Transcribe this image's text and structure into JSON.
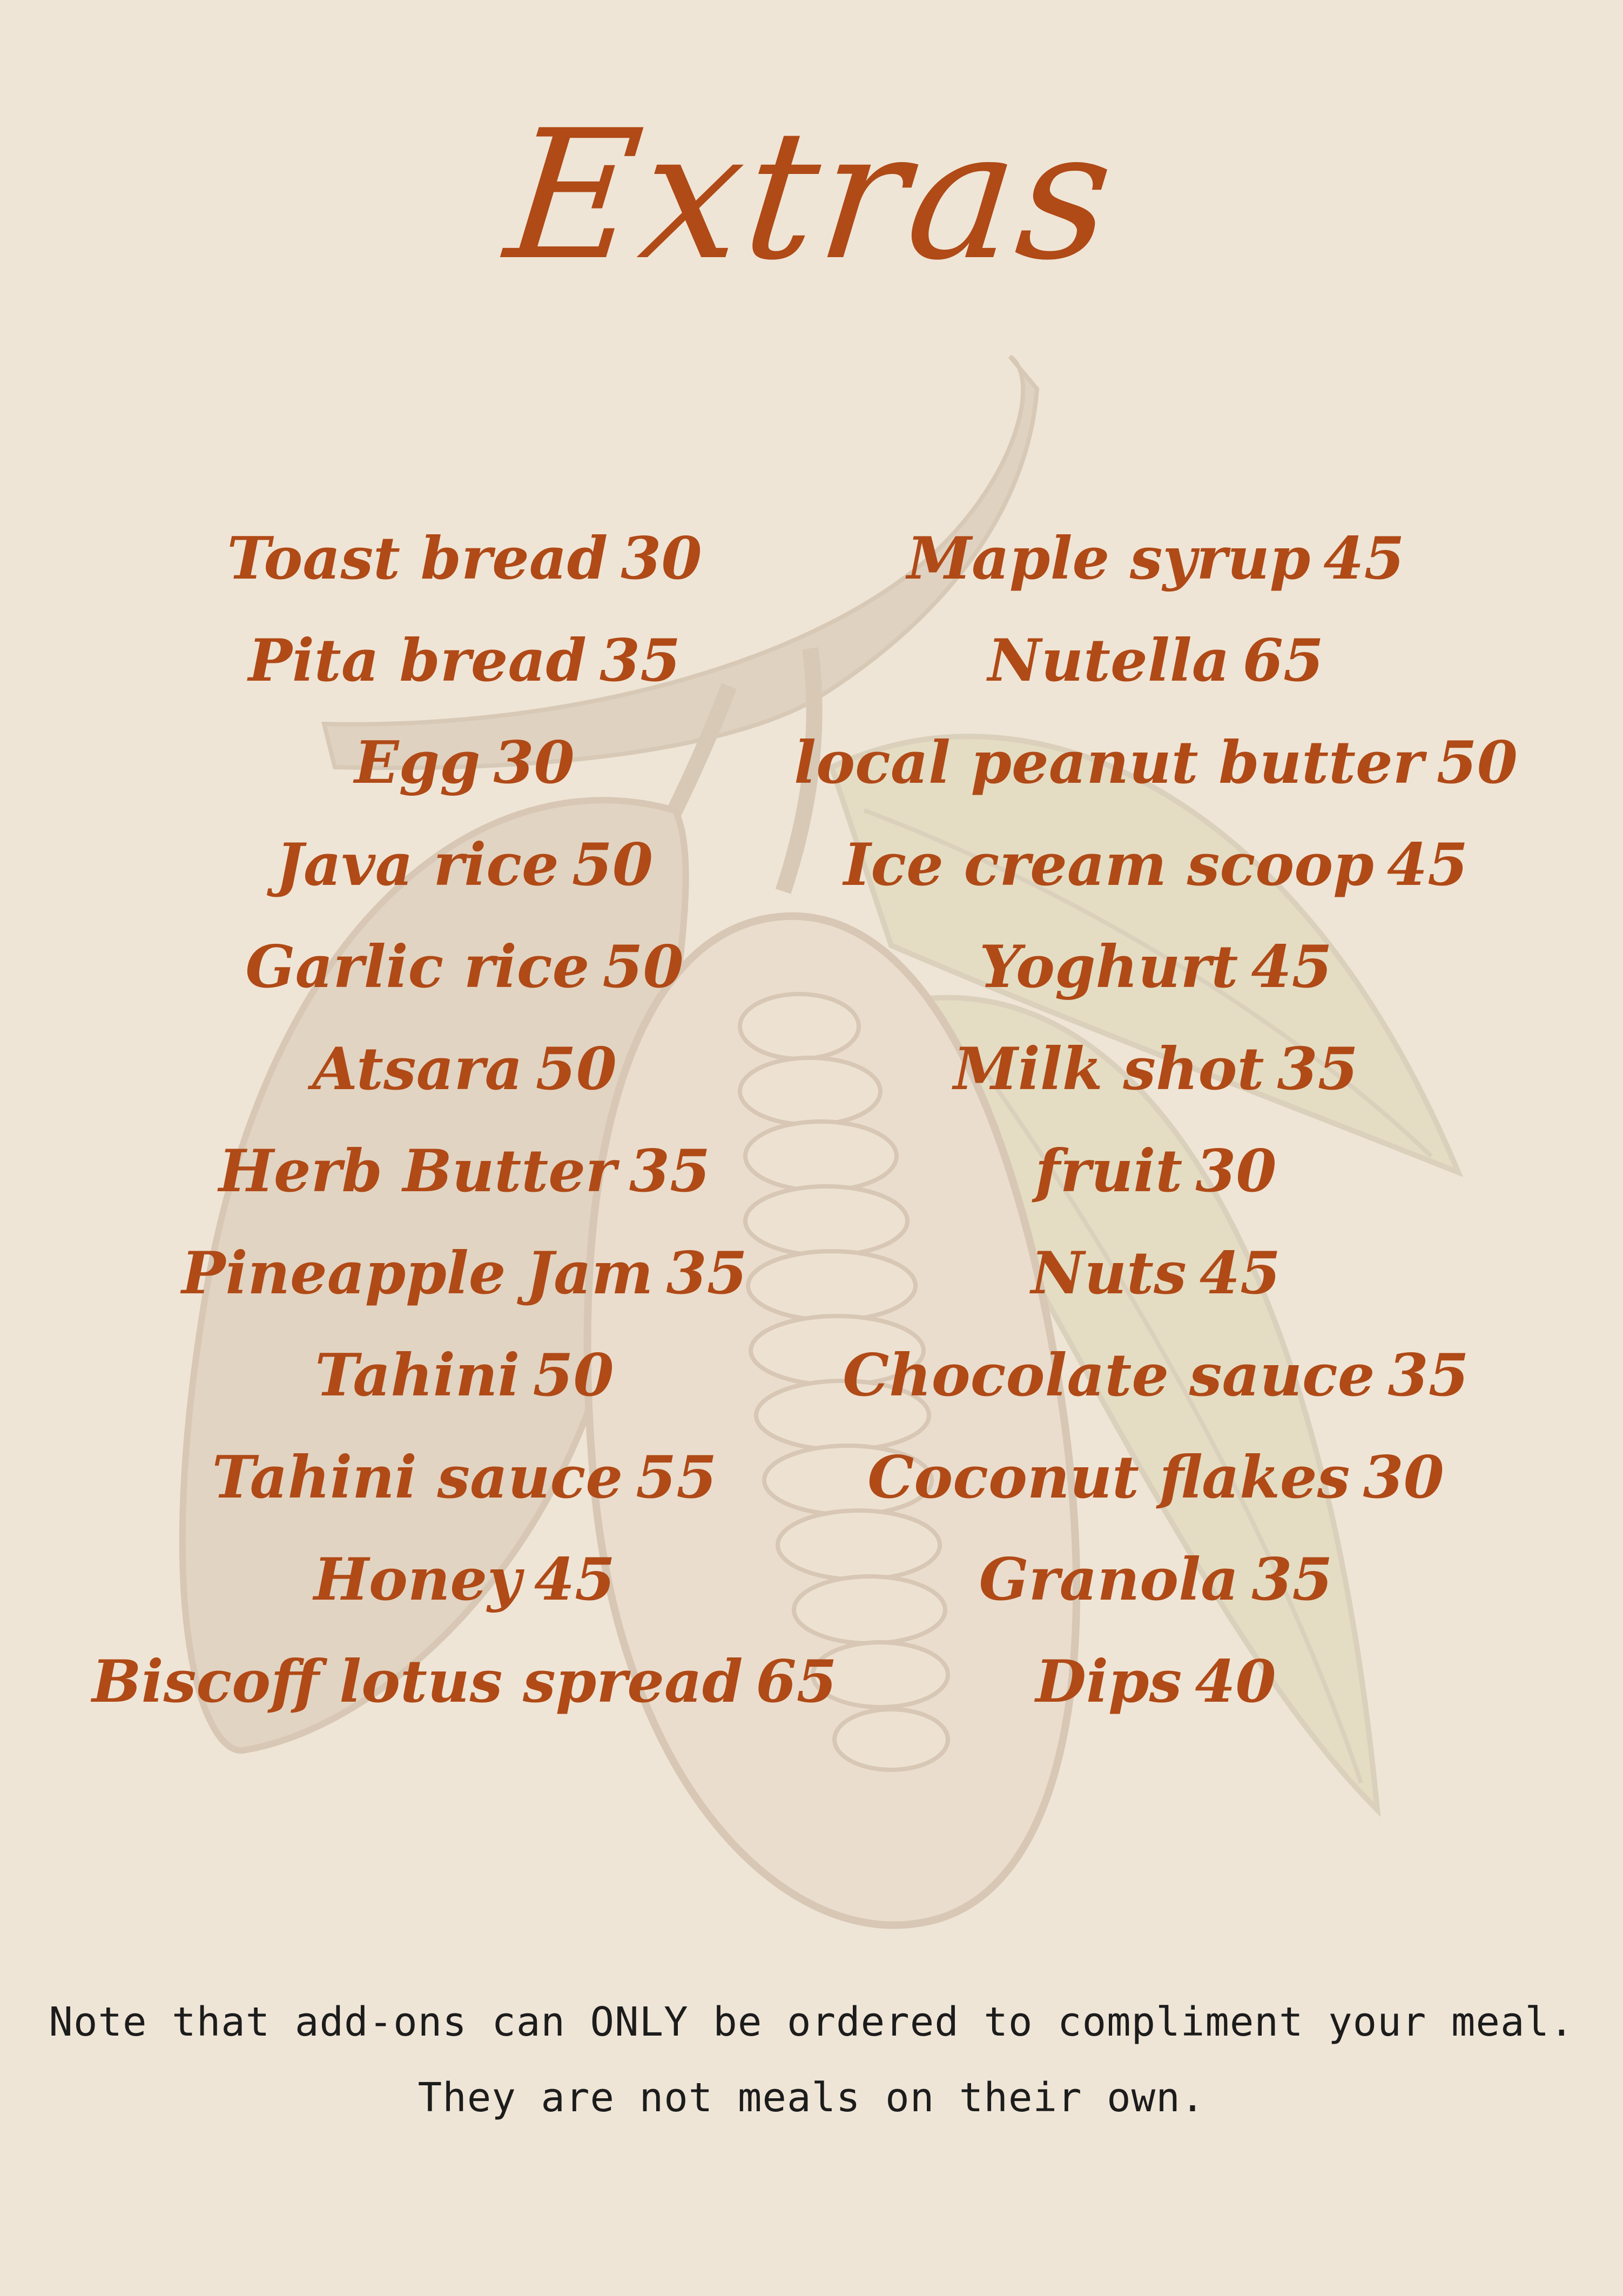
{
  "title": "Extras",
  "left_items": [
    {
      "name": "Toast bread",
      "price": "30"
    },
    {
      "name": "Pita bread",
      "price": "35"
    },
    {
      "name": "Egg",
      "price": "30"
    },
    {
      "name": "Java rice",
      "price": "50"
    },
    {
      "name": "Garlic rice",
      "price": "50"
    },
    {
      "name": "Atsara",
      "price": "50"
    },
    {
      "name": "Herb Butter",
      "price": "35"
    },
    {
      "name": "Pineapple Jam",
      "price": "35"
    },
    {
      "name": "Tahini",
      "price": "50"
    },
    {
      "name": "Tahini sauce",
      "price": "55"
    },
    {
      "name": "Honey",
      "price": "45"
    },
    {
      "name": "Biscoff lotus spread",
      "price": "65"
    }
  ],
  "right_items": [
    {
      "name": "Maple syrup",
      "price": "45"
    },
    {
      "name": "Nutella",
      "price": "65"
    },
    {
      "name": "local peanut butter",
      "price": "50"
    },
    {
      "name": "Ice cream scoop",
      "price": "45"
    },
    {
      "name": "Yoghurt",
      "price": "45"
    },
    {
      "name": "Milk shot",
      "price": "35"
    },
    {
      "name": "fruit",
      "price": "30"
    },
    {
      "name": "Nuts",
      "price": "45"
    },
    {
      "name": "Chocolate sauce",
      "price": "35"
    },
    {
      "name": "Coconut flakes",
      "price": "30"
    },
    {
      "name": "Granola",
      "price": "35"
    },
    {
      "name": "Dips",
      "price": "40"
    }
  ],
  "note_line1": "Note that add-ons can ONLY be ordered to compliment your meal.",
  "note_line2": "They are not meals on their own.",
  "colors": {
    "background": "#efe5d6",
    "accent": "#b04a17",
    "illustration": "#d9c8b5",
    "leaf": "#ddd9ba",
    "note_text": "#1c1c1c"
  },
  "background_icon": "cacao-pod-illustration"
}
